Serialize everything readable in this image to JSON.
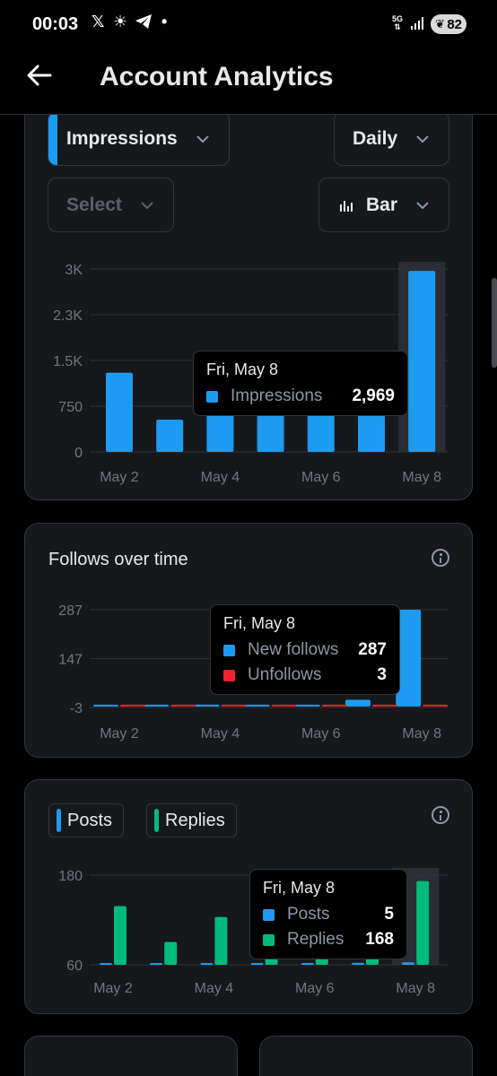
{
  "status_bar": {
    "time": "00:03",
    "network": "5G",
    "battery": "82"
  },
  "header": {
    "title": "Account Analytics"
  },
  "controls": {
    "metric": "Impressions",
    "interval": "Daily",
    "compare": "Select",
    "chart_type": "Bar"
  },
  "colors": {
    "blue": "#1d9bf0",
    "green": "#00ba7c",
    "red": "#f4212e",
    "card": "#16181c"
  },
  "impressions_chart": {
    "tooltip": {
      "date": "Fri, May 8",
      "label": "Impressions",
      "value": "2,969"
    },
    "chart_data": {
      "type": "bar",
      "categories": [
        "May 2",
        "May 3",
        "May 4",
        "May 5",
        "May 6",
        "May 7",
        "May 8"
      ],
      "x_tick_labels": [
        "May 2",
        "May 4",
        "May 6",
        "May 8"
      ],
      "y_tick_labels": [
        "3K",
        "2.3K",
        "1.5K",
        "750",
        "0"
      ],
      "ylim": [
        0,
        3000
      ],
      "series": [
        {
          "name": "Impressions",
          "values": [
            1300,
            530,
            600,
            600,
            600,
            600,
            2969
          ]
        }
      ]
    }
  },
  "follows_chart": {
    "title": "Follows over time",
    "tooltip": {
      "date": "Fri, May 8",
      "rows": [
        {
          "label": "New follows",
          "value": "287"
        },
        {
          "label": "Unfollows",
          "value": "3"
        }
      ]
    },
    "chart_data": {
      "type": "bar",
      "categories": [
        "May 2",
        "May 3",
        "May 4",
        "May 5",
        "May 6",
        "May 7",
        "May 8"
      ],
      "x_tick_labels": [
        "May 2",
        "May 4",
        "May 6",
        "May 8"
      ],
      "y_tick_labels": [
        "287",
        "147",
        "-3"
      ],
      "ylim": [
        -3,
        287
      ],
      "series": [
        {
          "name": "New follows",
          "values": [
            4,
            2,
            1,
            0,
            0,
            20,
            287
          ]
        },
        {
          "name": "Unfollows",
          "values": [
            1,
            1,
            0,
            0,
            1,
            0,
            3
          ]
        }
      ]
    }
  },
  "posts_chart": {
    "toggles": [
      "Posts",
      "Replies"
    ],
    "tooltip": {
      "date": "Fri, May 8",
      "rows": [
        {
          "label": "Posts",
          "value": "5"
        },
        {
          "label": "Replies",
          "value": "168"
        }
      ]
    },
    "chart_data": {
      "type": "bar",
      "categories": [
        "May 2",
        "May 3",
        "May 4",
        "May 5",
        "May 6",
        "May 7",
        "May 8"
      ],
      "x_tick_labels": [
        "May 2",
        "May 4",
        "May 6",
        "May 8"
      ],
      "y_tick_labels": [
        "180",
        "60"
      ],
      "ylim": [
        0,
        180
      ],
      "series": [
        {
          "name": "Posts",
          "values": [
            2,
            1,
            1,
            3,
            3,
            4,
            5
          ]
        },
        {
          "name": "Replies",
          "values": [
            118,
            46,
            96,
            20,
            20,
            20,
            168
          ]
        }
      ]
    }
  }
}
